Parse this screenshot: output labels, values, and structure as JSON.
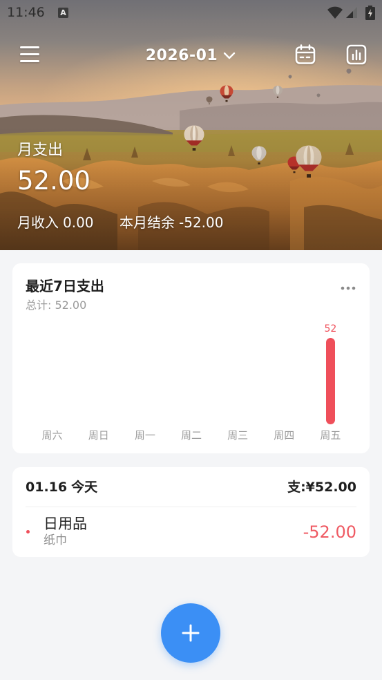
{
  "status_bar": {
    "time": "11:46",
    "notification_letter": "A",
    "icons": [
      "wifi-icon",
      "signal-icon",
      "battery-charging-icon"
    ]
  },
  "header": {
    "month": "2026-01",
    "icons": {
      "menu": "menu-icon",
      "month_dropdown": "chevron-down-icon",
      "calendar": "calendar-icon",
      "statistics": "bar-chart-icon"
    }
  },
  "summary": {
    "expense_label": "月支出",
    "expense_value": "52.00",
    "income_label": "月收入",
    "income_value": "0.00",
    "balance_label": "本月结余",
    "balance_value": "-52.00"
  },
  "weekly_card": {
    "more_icon": "more-horizontal-icon"
  },
  "chart_data": {
    "type": "bar",
    "title": "最近7日支出",
    "subtitle": "总计: 52.00",
    "categories": [
      "周六",
      "周日",
      "周一",
      "周二",
      "周三",
      "周四",
      "周五"
    ],
    "values": [
      0,
      0,
      0,
      0,
      0,
      0,
      52
    ],
    "xlabel": "",
    "ylabel": "",
    "ylim": [
      0,
      52
    ],
    "grid": false,
    "legend": "none",
    "show_data_labels": "nonzero-only"
  },
  "day_group": {
    "date": "01.16",
    "day_label": "今天",
    "expense_label": "支:",
    "expense_total": "¥52.00",
    "records": [
      {
        "category": "日用品",
        "note": "纸巾",
        "amount": "-52.00",
        "icon": "category-dot-icon"
      }
    ]
  },
  "fab": {
    "icon": "plus-icon"
  },
  "colors": {
    "accent": "#3b8ff5",
    "expense": "#ef4f5a",
    "page_background": "#f4f5f7",
    "card_background": "#ffffff",
    "secondary_text": "#9a9a9a"
  }
}
